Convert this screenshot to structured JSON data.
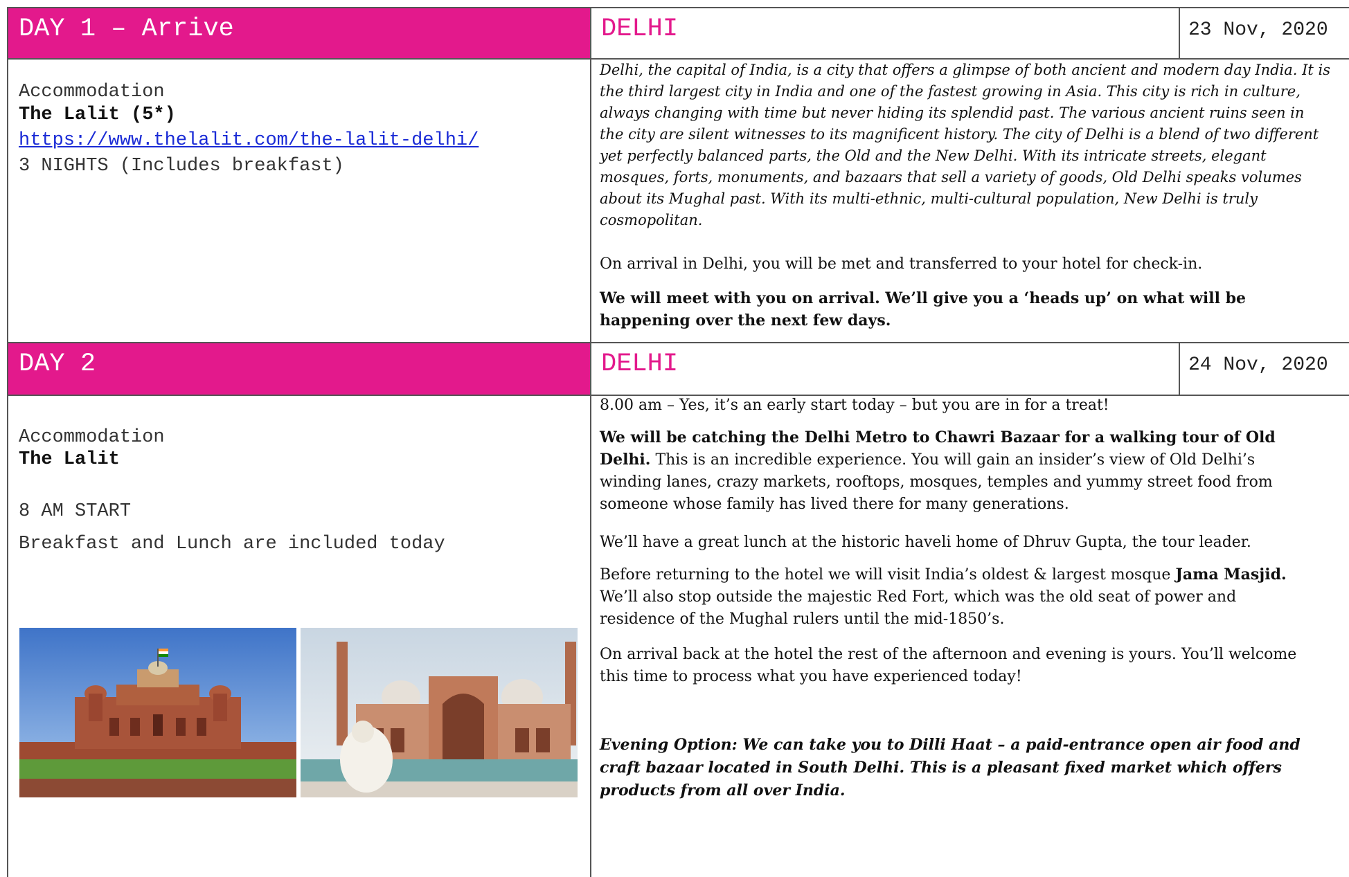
{
  "day1": {
    "header": "DAY 1 – Arrive",
    "city": "DELHI",
    "date": "23 Nov, 2020",
    "accommodation_label": "Accommodation",
    "hotel": "The Lalit (5*)",
    "hotel_url": "https://www.thelalit.com/the-lalit-delhi/",
    "nights": "3 NIGHTS (Includes breakfast)",
    "intro_lines": [
      "Delhi, the capital of India, is a city that offers a glimpse of both ancient and modern day India. It is",
      "the third largest city in India and one of the fastest growing in Asia. This city is rich in culture,",
      "always changing with time but never hiding its splendid past. The various ancient ruins seen in",
      "the city are silent witnesses to its magnificent history. The city of Delhi is a blend of two different",
      "yet perfectly balanced parts, the Old and the New Delhi. With its intricate streets, elegant",
      "mosques, forts, monuments, and bazaars that sell a variety of goods, Old Delhi speaks volumes",
      "about its Mughal past. With its multi-ethnic, multi-cultural population, New Delhi is truly",
      "cosmopolitan."
    ],
    "arrival": "On arrival in Delhi, you will be met and transferred to your hotel for check-in.",
    "meet_line1": "We will meet with you on arrival. We’ll give you a ‘heads up’ on what will be",
    "meet_line2": "happening over the next few days."
  },
  "day2": {
    "header": "DAY 2",
    "city": "DELHI",
    "date": "24 Nov, 2020",
    "accommodation_label": "Accommodation",
    "hotel": "The Lalit",
    "start": "8 AM START",
    "meals": "Breakfast and Lunch are included today",
    "p1": "8.00 am – Yes, it’s an early start today – but you are in for a treat!",
    "p2_bold_line1": "We will be catching the Delhi Metro to Chawri Bazaar for a walking tour of Old",
    "p2_bold_line2": "Delhi.",
    "p2_rest_line2": "  This is an incredible experience.  You will gain an insider’s view of Old Delhi’s",
    "p2_line3": "winding lanes, crazy markets, rooftops, mosques, temples and yummy street food from",
    "p2_line4": "someone whose family has lived there for many generations.",
    "p3": "We’ll have a great lunch at the historic haveli home of Dhruv Gupta, the tour leader.",
    "p4_line1": "Before returning to the hotel we will visit India’s oldest & largest mosque ",
    "p4_bold": "Jama Masjid.",
    "p4_line2": "We’ll also stop outside the majestic Red Fort, which was the old seat of power and",
    "p4_line3": "residence of the Mughal rulers until the mid-1850’s.",
    "p5_line1": "On arrival back at the hotel the rest of the afternoon and evening is yours.  You’ll welcome",
    "p5_line2": "this time to process what you have experienced today!",
    "evening_line1": "Evening Option:  We can take you to Dilli Haat – a paid-entrance open air food and",
    "evening_line2": "craft bazaar located in South Delhi.  This is a pleasant fixed market which offers",
    "evening_line3": "products from all over India."
  },
  "colors": {
    "accent": "#e3198c",
    "link": "#1a2bd6",
    "rule": "#555555"
  }
}
